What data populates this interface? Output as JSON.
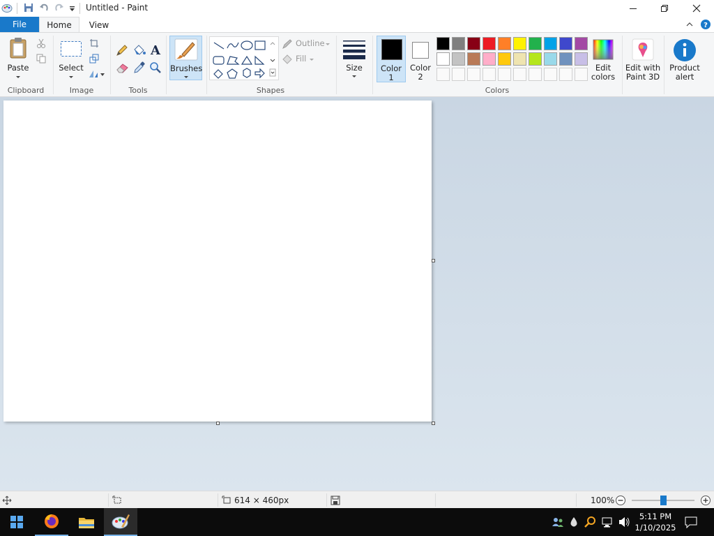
{
  "window": {
    "title": "Untitled - Paint",
    "controls": {
      "minimize": "minimize-icon",
      "maximize": "maximize-icon",
      "close": "close-icon"
    }
  },
  "quick_access": [
    "save-icon",
    "undo-icon",
    "redo-icon",
    "customize-icon"
  ],
  "tabs": {
    "file": "File",
    "home": "Home",
    "view": "View",
    "active": "Home"
  },
  "ribbon": {
    "clipboard": {
      "label": "Clipboard",
      "paste": "Paste",
      "cut_icon": "scissors-icon",
      "copy_icon": "copy-icon"
    },
    "image": {
      "label": "Image",
      "select": "Select",
      "crop_icon": "crop-icon",
      "resize_icon": "resize-icon",
      "rotate_icon": "rotate-icon"
    },
    "tools": {
      "label": "Tools",
      "pencil_icon": "pencil-icon",
      "fill_icon": "fill-bucket-icon",
      "text_icon": "text-icon",
      "eraser_icon": "eraser-icon",
      "picker_icon": "color-picker-icon",
      "magnifier_icon": "magnifier-icon"
    },
    "brushes": {
      "label": "Brushes"
    },
    "shapes": {
      "label": "Shapes",
      "outline": "Outline",
      "fill": "Fill"
    },
    "size": {
      "label": "Size"
    },
    "colors": {
      "label": "Colors",
      "color1": "Color\n1",
      "color1_line1": "Color",
      "color1_line2": "1",
      "color2_line1": "Color",
      "color2_line2": "2",
      "color1_value": "#000000",
      "color2_value": "#ffffff",
      "palette_row1": [
        "#000000",
        "#7f7f7f",
        "#880015",
        "#ed1c24",
        "#ff7f27",
        "#fff200",
        "#22b14c",
        "#00a2e8",
        "#3f48cc",
        "#a349a4"
      ],
      "palette_row2": [
        "#ffffff",
        "#c3c3c3",
        "#b97a57",
        "#ffaec9",
        "#ffc90e",
        "#efe4b0",
        "#b5e61d",
        "#99d9ea",
        "#7092be",
        "#c8bfe7"
      ],
      "edit_line1": "Edit",
      "edit_line2": "colors"
    },
    "paint3d": {
      "line1": "Edit with",
      "line2": "Paint 3D"
    },
    "product_alert": {
      "line1": "Product",
      "line2": "alert"
    }
  },
  "statusbar": {
    "canvas_size": "614 × 460px",
    "zoom": "100%",
    "zoom_level": 1.0
  },
  "taskbar": {
    "apps": [
      "windows-start-icon",
      "firefox-icon",
      "file-explorer-icon",
      "paint-icon"
    ],
    "time": "5:11 PM",
    "date": "1/10/2025"
  }
}
